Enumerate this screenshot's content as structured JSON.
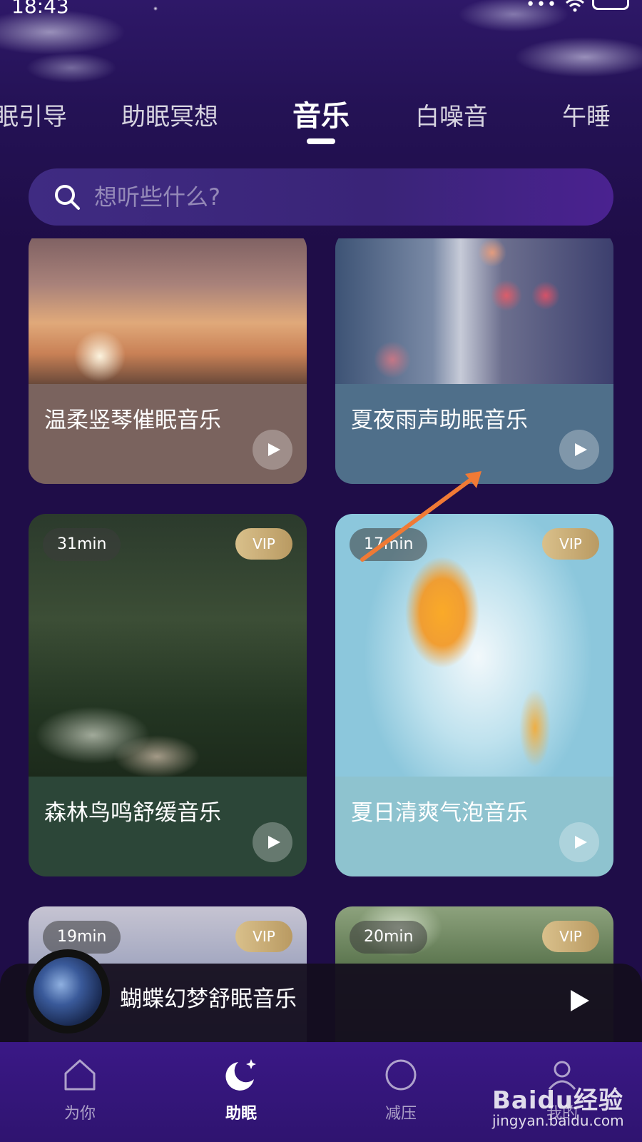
{
  "status_bar": {
    "time": "18:43",
    "battery": ""
  },
  "tabs": [
    {
      "label": "眠引导",
      "active": false
    },
    {
      "label": "助眠冥想",
      "active": false
    },
    {
      "label": "音乐",
      "active": true
    },
    {
      "label": "白噪音",
      "active": false
    },
    {
      "label": "午睡",
      "active": false
    }
  ],
  "search": {
    "placeholder": "想听些什么?"
  },
  "cards": [
    {
      "title": "温柔竖琴催眠音乐",
      "duration": "",
      "vip": ""
    },
    {
      "title": "夏夜雨声助眠音乐",
      "duration": "",
      "vip": ""
    },
    {
      "title": "森林鸟鸣舒缓音乐",
      "duration": "31min",
      "vip": "VIP"
    },
    {
      "title": "夏日清爽气泡音乐",
      "duration": "17min",
      "vip": "VIP"
    },
    {
      "title": "",
      "duration": "19min",
      "vip": "VIP"
    },
    {
      "title": "",
      "duration": "20min",
      "vip": "VIP"
    }
  ],
  "mini_player": {
    "title": "蝴蝶幻梦舒眠音乐"
  },
  "bottom_nav": [
    {
      "label": "为你",
      "icon": "home-icon",
      "active": false
    },
    {
      "label": "助眠",
      "icon": "moon-icon",
      "active": true
    },
    {
      "label": "减压",
      "icon": "circle-icon",
      "active": false
    },
    {
      "label": "我的",
      "icon": "profile-icon",
      "active": false
    }
  ],
  "watermark": {
    "brand": "Baidu经验",
    "url": "jingyan.baidu.com"
  },
  "colors": {
    "background": "#1f0d48",
    "nav_background": "#3a1886",
    "vip_gold": "#c9ac74",
    "annotation_arrow": "#f07a35"
  }
}
